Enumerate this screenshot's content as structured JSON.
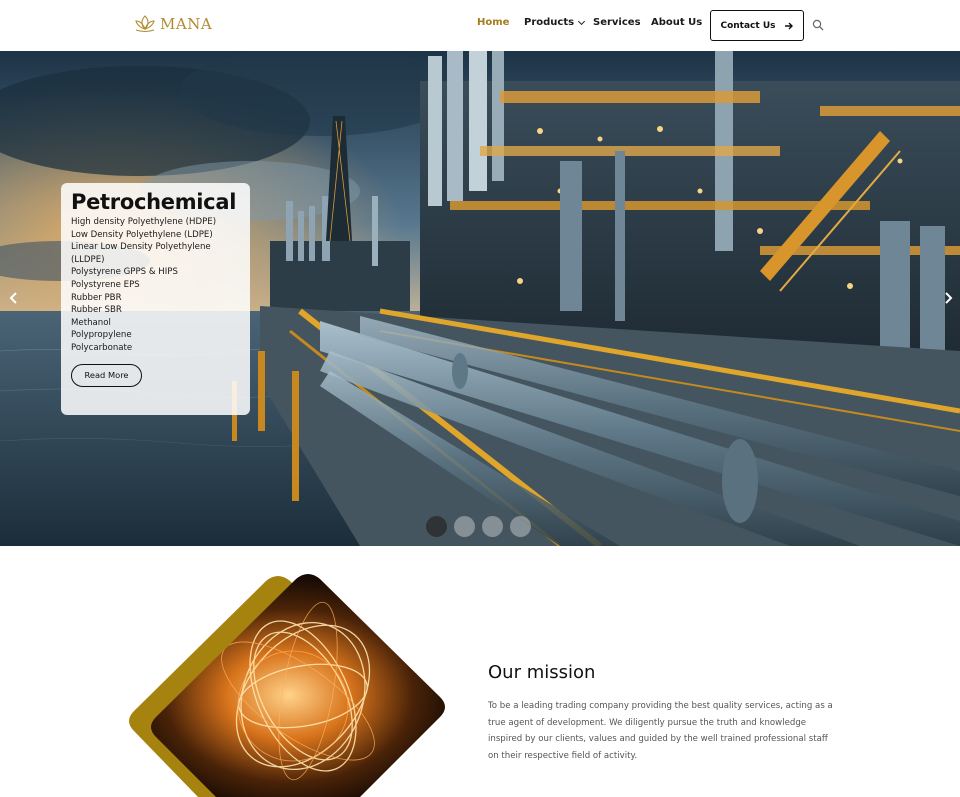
{
  "header": {
    "logo_text": "MANA",
    "nav": {
      "home": "Home",
      "products": "Products",
      "services": "Services",
      "about": "About Us"
    },
    "contact_label": "Contact Us"
  },
  "hero": {
    "title": "Petrochemical",
    "items": [
      "High density Polyethylene (HDPE)",
      "Low Density Polyethylene (LDPE)",
      "Linear Low Density Polyethylene (LLDPE)",
      "Polystyrene GPPS & HIPS",
      "Polystyrene EPS",
      "Rubber PBR",
      "Rubber SBR",
      "Methanol",
      "Polypropylene",
      "Polycarbonate"
    ],
    "read_more_label": "Read More",
    "slide_count": 4,
    "active_slide": 1
  },
  "mission": {
    "title": "Our mission",
    "text": "To be a leading trading company providing the best quality services, acting as a true agent of development. We diligently pursue the truth and knowledge inspired by our clients, values and guided by the well trained professional staff on their respective field of activity."
  },
  "colors": {
    "accent_gold": "#a27d1c",
    "brand_gold": "#b08a2e",
    "text_dark": "#111111",
    "text_muted": "#555555"
  },
  "icons": {
    "logo": "lotus-icon",
    "products_dropdown": "chevron-down-icon",
    "contact_arrow": "arrow-right-icon",
    "search": "search-icon",
    "prev": "chevron-left-icon",
    "next": "chevron-right-icon"
  }
}
